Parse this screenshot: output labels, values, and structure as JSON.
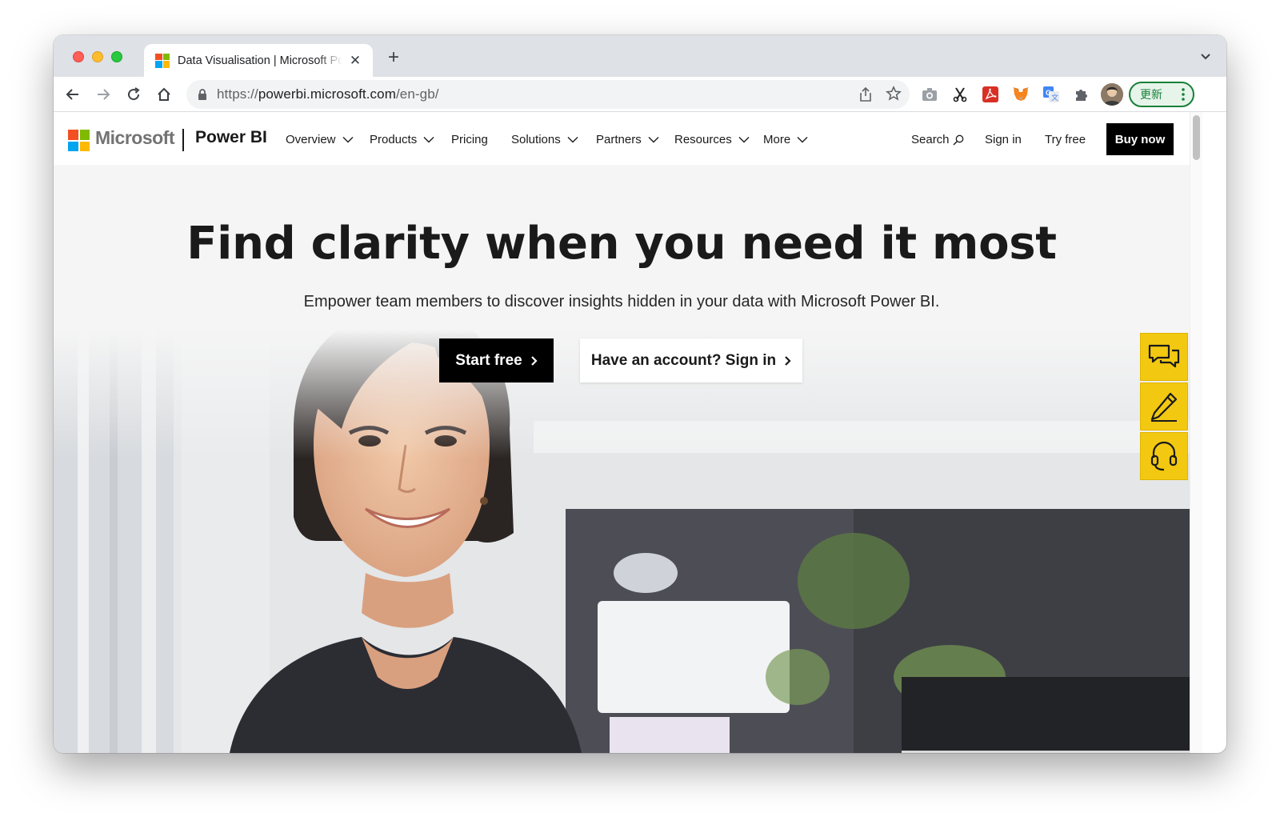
{
  "browser": {
    "tab": {
      "title": "Data Visualisation | Microsoft Power BI"
    },
    "url": {
      "prefix": "https://",
      "host": "powerbi.microsoft.com",
      "path": "/en-gb/"
    },
    "update_label": "更新",
    "colors": {
      "tabstrip": "#dee1e6",
      "update_green": "#188038"
    }
  },
  "site": {
    "brand": "Microsoft",
    "product": "Power BI",
    "nav": [
      {
        "label": "Overview"
      },
      {
        "label": "Products"
      },
      {
        "label": "Pricing"
      },
      {
        "label": "Solutions"
      },
      {
        "label": "Partners"
      },
      {
        "label": "Resources"
      },
      {
        "label": "More"
      }
    ],
    "header_right": {
      "search": "Search",
      "sign_in": "Sign in",
      "try_free": "Try free",
      "buy_now": "Buy now"
    }
  },
  "hero": {
    "title": "Find clarity when you need it most",
    "subtitle": "Empower team members to discover insights hidden in your data with Microsoft Power BI.",
    "start_free": "Start free",
    "sign_in": "Have an account? Sign in"
  },
  "side_tools": [
    "chat-icon",
    "pencil-icon",
    "headset-icon"
  ],
  "colors": {
    "side_tool": "#f2c811",
    "ms_red": "#f25022",
    "ms_green": "#7fba00",
    "ms_blue": "#00a4ef",
    "ms_yellow": "#ffb900"
  }
}
